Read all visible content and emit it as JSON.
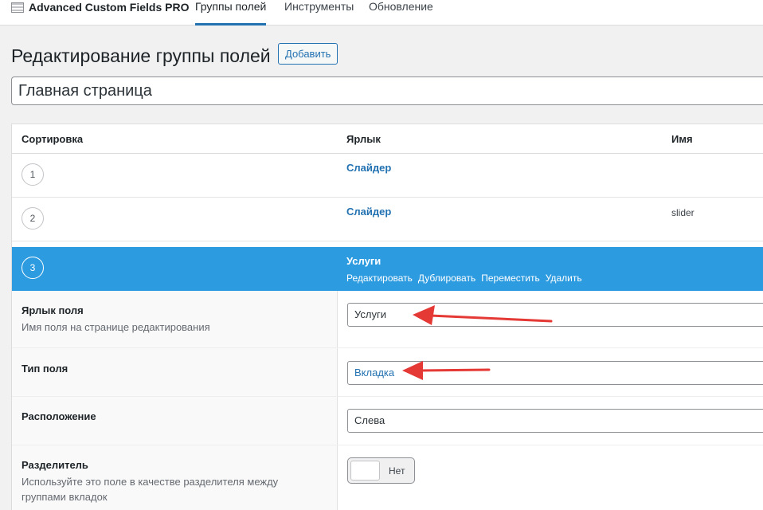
{
  "topbar": {
    "brand": "Advanced Custom Fields PRO",
    "tabs": [
      {
        "label": "Группы полей",
        "active": true
      },
      {
        "label": "Инструменты",
        "active": false
      },
      {
        "label": "Обновление",
        "active": false
      }
    ]
  },
  "header": {
    "title": "Редактирование группы полей",
    "add_button": "Добавить",
    "group_title_value": "Главная страница"
  },
  "fields_table": {
    "columns": [
      "Сортировка",
      "Ярлык",
      "Имя"
    ],
    "rows": [
      {
        "order": "1",
        "label": "Слайдер",
        "name": ""
      },
      {
        "order": "2",
        "label": "Слайдер",
        "name": "slider"
      },
      {
        "order": "3",
        "label": "Услуги",
        "name": "",
        "open": true
      }
    ],
    "row_actions": [
      "Редактировать",
      "Дублировать",
      "Переместить",
      "Удалить"
    ]
  },
  "settings": {
    "field_label": {
      "label": "Ярлык поля",
      "hint": "Имя поля на странице редактирования",
      "value": "Услуги"
    },
    "field_type": {
      "label": "Тип поля",
      "value": "Вкладка"
    },
    "placement": {
      "label": "Расположение",
      "value": "Слева"
    },
    "endpoint": {
      "label": "Разделитель",
      "hint": "Используйте это поле в качестве разделителя между группами вкладок",
      "toggle_text": "Нет",
      "enabled": false
    }
  },
  "colors": {
    "accent": "#2271b1",
    "open_row": "#2c9be0",
    "annotation_arrow": "#e53935"
  }
}
